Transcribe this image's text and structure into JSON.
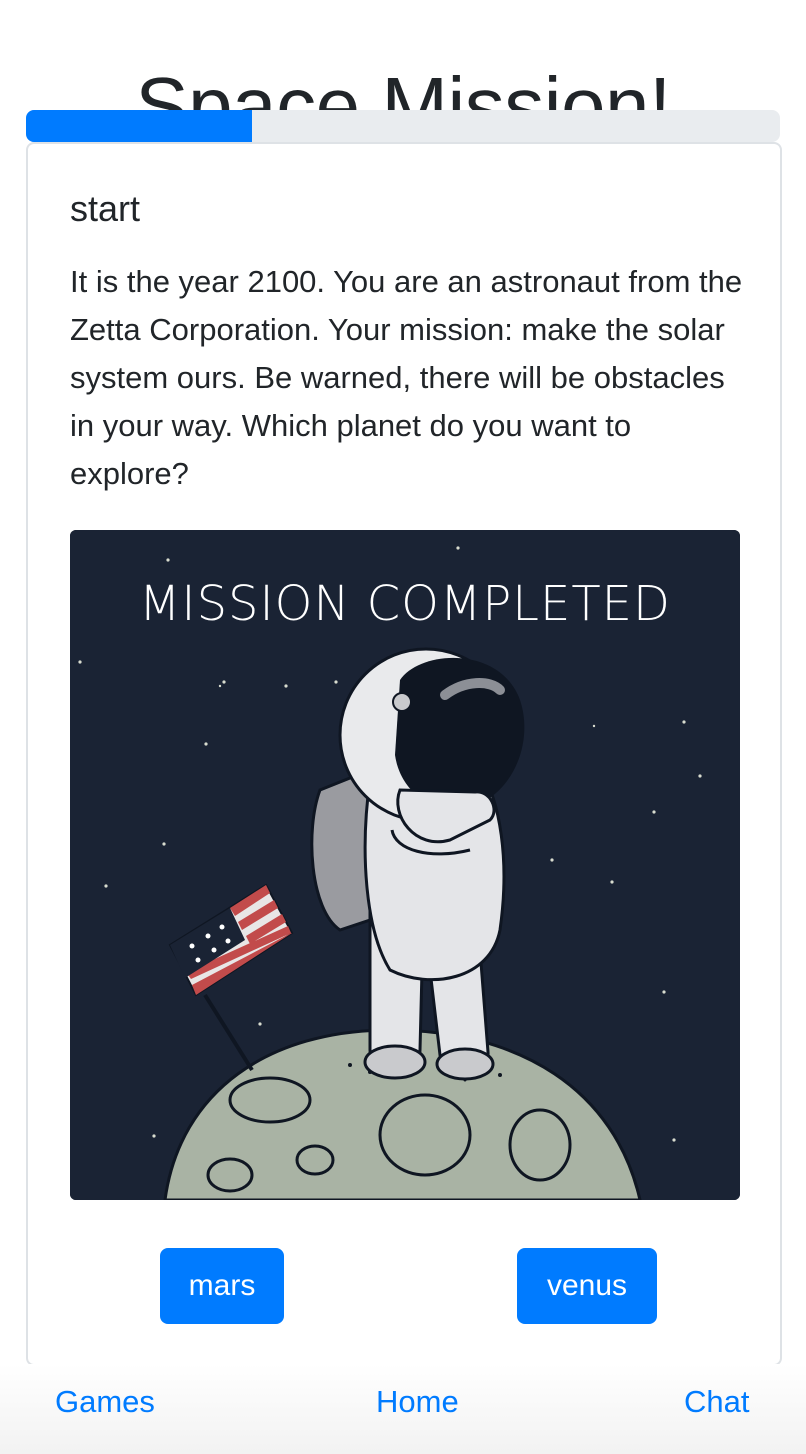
{
  "header": {
    "title": "Space Mission!"
  },
  "progress": {
    "fraction": 0.3
  },
  "card": {
    "title": "start",
    "text": "It is the year 2100. You are an astronaut from the Zetta Corporation. Your mission: make the solar system ours. Be warned, there will be obstacles in your way. Which planet do you want to explore?",
    "image": {
      "caption_text": "MISSION COMPLETED",
      "subject": "astronaut-saluting-on-moon-with-flag"
    },
    "choices": [
      {
        "label": "mars"
      },
      {
        "label": "venus"
      }
    ]
  },
  "footer_nav": {
    "items": [
      {
        "label": "Games"
      },
      {
        "label": "Home"
      },
      {
        "label": "Chat"
      }
    ]
  },
  "colors": {
    "primary": "#007bff",
    "text": "#212529",
    "progress_track": "#e9ecef",
    "image_bg": "#1a2334",
    "border": "#dee2e6"
  }
}
